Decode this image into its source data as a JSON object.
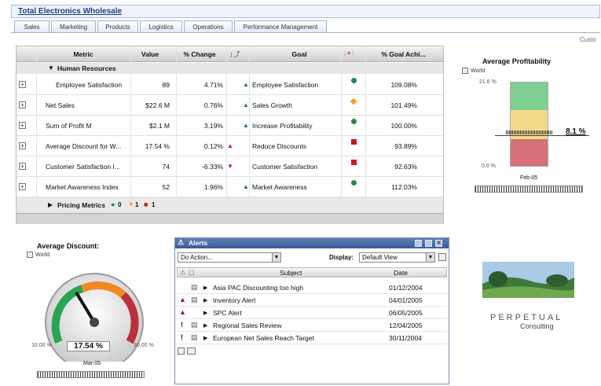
{
  "app": {
    "title": "Total Electronics Wholesale",
    "customize_label": "Custo"
  },
  "tabs": [
    "Sales",
    "Marketing",
    "Products",
    "Logistics",
    "Operations",
    "Performance Management"
  ],
  "grid": {
    "headers": {
      "metric": "Metric",
      "value": "Value",
      "change": "% Change",
      "goal": "Goal",
      "goal_ach": "% Goal Achi..."
    },
    "group_label": "Human Resources",
    "rows": [
      {
        "metric": "Employee Satisfaction",
        "value": "89",
        "change": "4.71%",
        "trend": "up",
        "goal": "Employee Satisfaction",
        "status": "green",
        "achieve": "109.08%"
      },
      {
        "metric": "Net Sales",
        "value": "$22.6 M",
        "change": "0.76%",
        "trend": "up",
        "goal": "Sales Growth",
        "status": "orange",
        "achieve": "101.49%"
      },
      {
        "metric": "Sum of Profit M",
        "value": "$2.1 M",
        "change": "3.19%",
        "trend": "up",
        "goal": "Increase Profitability",
        "status": "green",
        "achieve": "100.00%"
      },
      {
        "metric": "Average Discount for W...",
        "value": "17.54 %",
        "change": "0.12%",
        "trend": "up-red",
        "goal": "Reduce Discounts",
        "status": "red",
        "achieve": "93.89%"
      },
      {
        "metric": "Customer Satisfaction I...",
        "value": "74",
        "change": "-6.33%",
        "trend": "down",
        "goal": "Customer Satisfaction",
        "status": "red",
        "achieve": "92.63%"
      },
      {
        "metric": "Market Awareness Index",
        "value": "52",
        "change": "1.96%",
        "trend": "up",
        "goal": "Market Awareness",
        "status": "green",
        "achieve": "112.03%"
      }
    ],
    "footer": {
      "label": "Pricing Metrics",
      "green_count": "0",
      "orange_count": "1",
      "red_count": "1"
    }
  },
  "profitability": {
    "title": "Average Profitability",
    "world_label": "World",
    "top_tick": "21.6 %",
    "bottom_tick": "0.0 %",
    "value_label": "8.1 %",
    "period": "Feb-05"
  },
  "gauge": {
    "title": "Average Discount:",
    "world_label": "World",
    "value": "17.54 %",
    "min_label": "10.00 %",
    "max_label": "30.00 %",
    "period": "Mar-05"
  },
  "alerts": {
    "title": "Alerts",
    "action_value": "Do Action...",
    "display_label": "Display:",
    "display_value": "Default View",
    "col_subject": "Subject",
    "col_date": "Date",
    "rows": [
      {
        "subject": "Asia PAC Discounting too high",
        "date": "01/12/2004",
        "severity": "none"
      },
      {
        "subject": "Inventory Alert",
        "date": "04/01/2005",
        "severity": "warning"
      },
      {
        "subject": "SPC Alert",
        "date": "06/05/2005",
        "severity": "warning"
      },
      {
        "subject": "Regional Sales Review",
        "date": "12/04/2005",
        "severity": "exclaim"
      },
      {
        "subject": "European Net Sales Reach Target",
        "date": "30/11/2004",
        "severity": "exclaim"
      }
    ]
  },
  "logo": {
    "brand": "PERPETUAL",
    "tagline": "Consulting"
  }
}
